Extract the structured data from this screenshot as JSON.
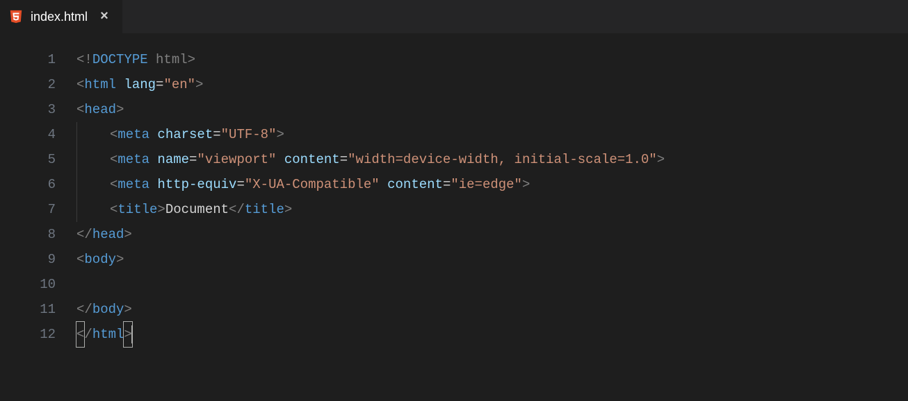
{
  "tab": {
    "label": "index.html",
    "icon": "html5",
    "close_glyph": "×"
  },
  "line_numbers": [
    "1",
    "2",
    "3",
    "4",
    "5",
    "6",
    "7",
    "8",
    "9",
    "10",
    "11",
    "12"
  ],
  "code": {
    "l1": {
      "p1": "<!",
      "p2": "DOCTYPE ",
      "p3": "html",
      "p4": ">"
    },
    "l2": {
      "p1": "<",
      "p2": "html ",
      "p3": "lang",
      "p4": "=",
      "p5": "\"en\"",
      "p6": ">"
    },
    "l3": {
      "p1": "<",
      "p2": "head",
      "p3": ">"
    },
    "l4": {
      "p1": "<",
      "p2": "meta ",
      "p3": "charset",
      "p4": "=",
      "p5": "\"UTF-8\"",
      "p6": ">"
    },
    "l5": {
      "p1": "<",
      "p2": "meta ",
      "p3": "name",
      "p4": "=",
      "p5": "\"viewport\"",
      "p6": " ",
      "p7": "content",
      "p8": "=",
      "p9": "\"width=device-width, initial-scale=1.0\"",
      "p10": ">"
    },
    "l6": {
      "p1": "<",
      "p2": "meta ",
      "p3": "http-equiv",
      "p4": "=",
      "p5": "\"X-UA-Compatible\"",
      "p6": " ",
      "p7": "content",
      "p8": "=",
      "p9": "\"ie=edge\"",
      "p10": ">"
    },
    "l7": {
      "p1": "<",
      "p2": "title",
      "p3": ">",
      "p4": "Document",
      "p5": "</",
      "p6": "title",
      "p7": ">"
    },
    "l8": {
      "p1": "</",
      "p2": "head",
      "p3": ">"
    },
    "l9": {
      "p1": "<",
      "p2": "body",
      "p3": ">"
    },
    "l10": {
      "blank": " "
    },
    "l11": {
      "p1": "</",
      "p2": "body",
      "p3": ">"
    },
    "l12": {
      "p1": "<",
      "p2": "/",
      "p3": "html",
      "p4": ">"
    }
  }
}
